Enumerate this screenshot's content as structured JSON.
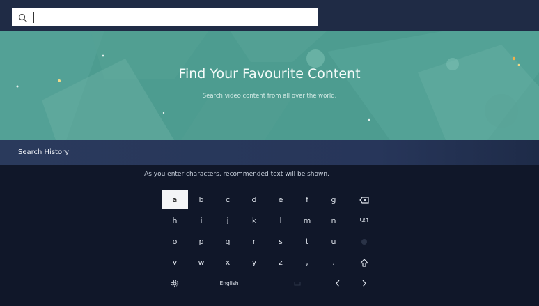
{
  "search": {
    "value": "",
    "placeholder": ""
  },
  "hero": {
    "title": "Find Your Favourite Content",
    "subtitle": "Search video content from all over the world."
  },
  "history": {
    "title": "Search History",
    "hint": "As you enter characters, recommended text will be shown."
  },
  "keyboard": {
    "selected_key": "a",
    "language": "English",
    "rows": [
      [
        "a",
        "b",
        "c",
        "d",
        "e",
        "f",
        "g",
        "backspace"
      ],
      [
        "h",
        "i",
        "j",
        "k",
        "l",
        "m",
        "n",
        "!#1"
      ],
      [
        "o",
        "p",
        "q",
        "r",
        "s",
        "t",
        "u",
        "disabled-key"
      ],
      [
        "v",
        "w",
        "x",
        "y",
        "z",
        ",",
        ".",
        "shift"
      ],
      [
        "settings",
        "English",
        "space",
        "left",
        "right"
      ]
    ],
    "labels": {
      "symbols": "!#1",
      "comma": ",",
      "period": "."
    }
  },
  "icons": {
    "search": "search-icon",
    "backspace": "backspace-icon",
    "shift": "shift-icon",
    "settings": "settings-icon",
    "left": "chevron-left-icon",
    "right": "chevron-right-icon",
    "space": "space-icon"
  },
  "colors": {
    "background": "#101729",
    "topbar": "#1f2b45",
    "hero": "#4d9c90",
    "history_band": "#2a3a5c",
    "selected_key_bg": "#f4f5f7"
  }
}
